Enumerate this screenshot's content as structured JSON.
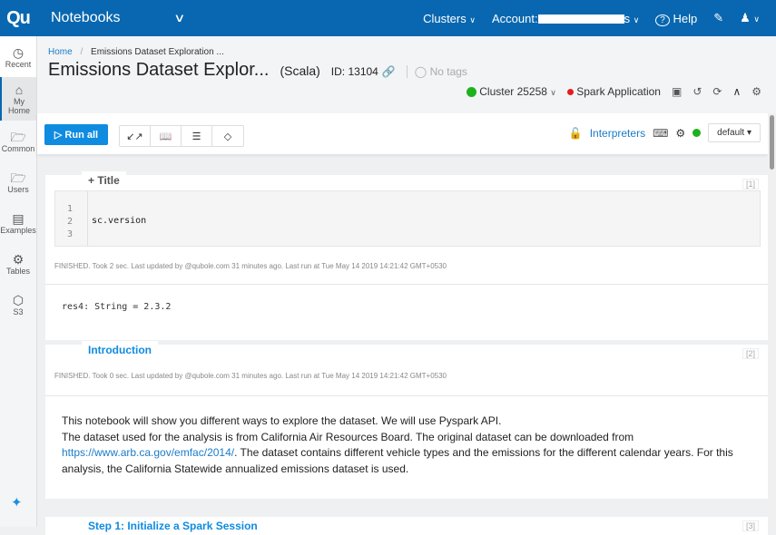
{
  "topbar": {
    "logo": "Qu",
    "app": "Notebooks",
    "clusters": "Clusters",
    "account_label": "Account:",
    "account_suffix": "s",
    "help": "Help"
  },
  "sidebar": {
    "items": [
      {
        "label": "Recent",
        "icon": "clock-icon"
      },
      {
        "label": "My Home",
        "icon": "home-folder-icon"
      },
      {
        "label": "Common",
        "icon": "common-folder-icon"
      },
      {
        "label": "Users",
        "icon": "users-folder-icon"
      },
      {
        "label": "Examples",
        "icon": "books-icon"
      },
      {
        "label": "Tables",
        "icon": "tables-icon"
      },
      {
        "label": "S3",
        "icon": "cube-icon"
      }
    ]
  },
  "header": {
    "breadcrumb_home": "Home",
    "breadcrumb_current": "Emissions Dataset Exploration ...",
    "title": "Emissions Dataset Explor...",
    "language": "(Scala)",
    "id": "ID: 13104",
    "tags": "No tags",
    "cluster": "Cluster 25258",
    "spark": "Spark Application"
  },
  "toolbar": {
    "run_all": "Run all",
    "interpreters": "Interpreters",
    "default_select": "default"
  },
  "colors": {
    "brand": "#0867b0",
    "accent": "#0f8be0",
    "cluster_status": "#1db11d",
    "spark_status": "#e51c1c"
  },
  "paragraphs": [
    {
      "tab": "+ Title",
      "num": "[1]",
      "lines": [
        "1",
        "2",
        "3"
      ],
      "code": "sc.version",
      "status": "FINISHED.  Took 2 sec. Last updated by          @qubole.com 31 minutes ago. Last run at Tue May 14 2019 14:21:42 GMT+0530",
      "output": "res4: String = 2.3.2"
    },
    {
      "tab": "Introduction",
      "num": "[2]",
      "status": "FINISHED.  Took 0 sec. Last updated by               @qubole.com 31 minutes ago. Last run at Tue May 14 2019 14:21:42 GMT+0530",
      "text1": "This notebook will show you different ways to explore the dataset. We will use Pyspark API.",
      "text2": "The dataset used for the analysis is from California Air Resources Board. The original dataset can be downloaded from",
      "link": "https://www.arb.ca.gov/emfac/2014/",
      "text3": ". The dataset contains different vehicle types and the emissions for the different calendar years. For this analysis, the California Statewide annualized emissions dataset is used."
    },
    {
      "tab": "Step 1: Initialize a Spark Session",
      "num": "[3]"
    }
  ]
}
